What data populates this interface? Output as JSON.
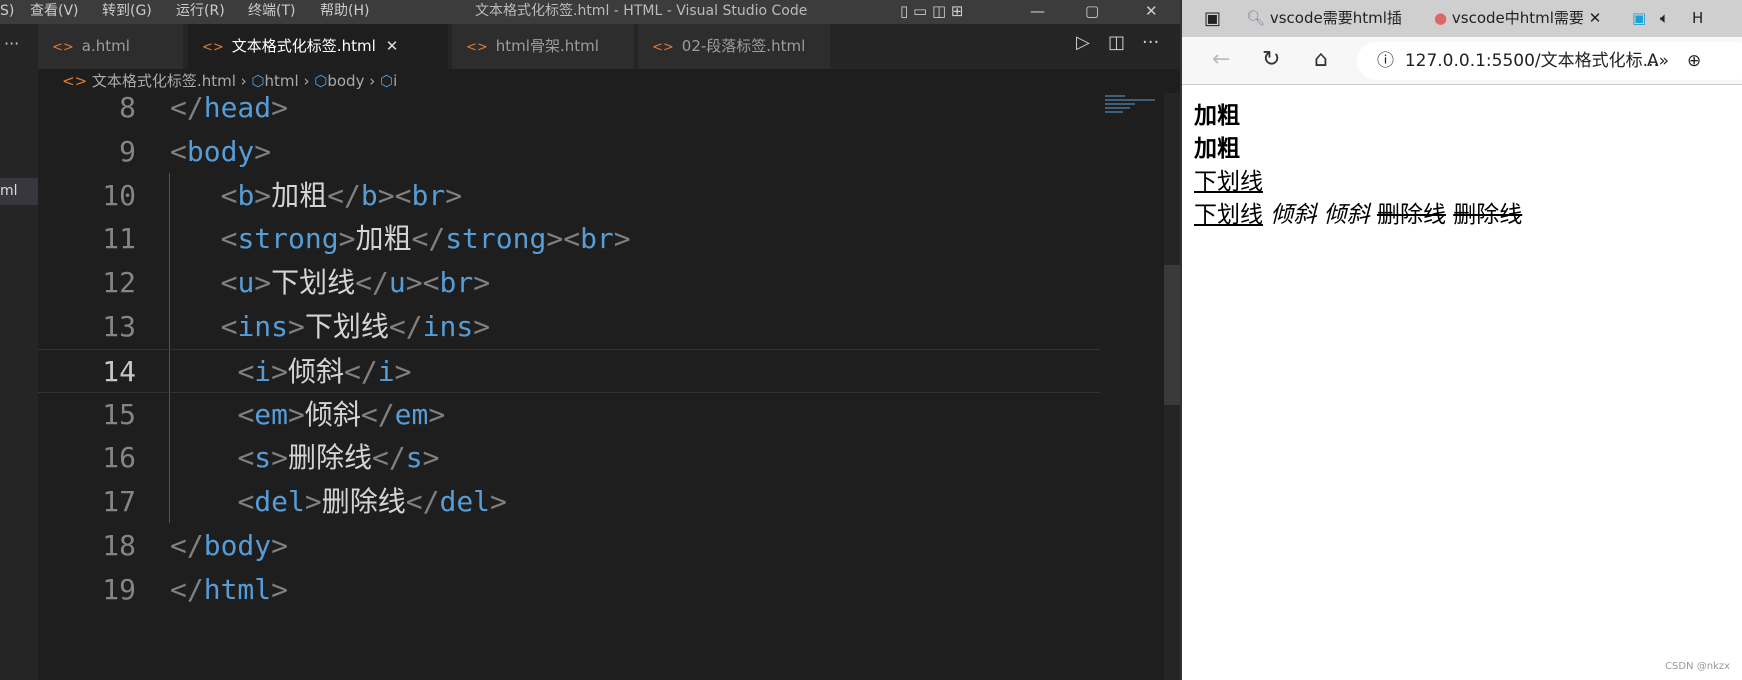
{
  "vscode": {
    "menu": [
      "S)",
      "查看(V)",
      "转到(G)",
      "运行(R)",
      "终端(T)",
      "帮助(H)"
    ],
    "window_title": "文本格式化标签.html - HTML - Visual Studio Code",
    "explorer_partial_item": "ml",
    "tabs": [
      {
        "label": "a.html",
        "active": false
      },
      {
        "label": "文本格式化标签.html",
        "active": true,
        "close": "✕"
      },
      {
        "label": "html骨架.html",
        "active": false
      },
      {
        "label": "02-段落标签.html",
        "active": false
      }
    ],
    "breadcrumb": [
      "文本格式化标签.html",
      "html",
      "body",
      "i"
    ],
    "code_lines": [
      {
        "n": "8",
        "tokens": [
          [
            "punct",
            "</"
          ],
          [
            "tag",
            "head"
          ],
          [
            "punct",
            ">"
          ]
        ]
      },
      {
        "n": "9",
        "tokens": [
          [
            "punct",
            "<"
          ],
          [
            "tag",
            "body"
          ],
          [
            "punct",
            ">"
          ]
        ]
      },
      {
        "n": "10",
        "tokens": [
          [
            "text",
            "   "
          ],
          [
            "punct",
            "<"
          ],
          [
            "tag",
            "b"
          ],
          [
            "punct",
            ">"
          ],
          [
            "text",
            "加粗"
          ],
          [
            "punct",
            "</"
          ],
          [
            "tag",
            "b"
          ],
          [
            "punct",
            "><"
          ],
          [
            "tag",
            "br"
          ],
          [
            "punct",
            ">"
          ]
        ]
      },
      {
        "n": "11",
        "tokens": [
          [
            "text",
            "   "
          ],
          [
            "punct",
            "<"
          ],
          [
            "tag",
            "strong"
          ],
          [
            "punct",
            ">"
          ],
          [
            "text",
            "加粗"
          ],
          [
            "punct",
            "</"
          ],
          [
            "tag",
            "strong"
          ],
          [
            "punct",
            "><"
          ],
          [
            "tag",
            "br"
          ],
          [
            "punct",
            ">"
          ]
        ]
      },
      {
        "n": "12",
        "tokens": [
          [
            "text",
            "   "
          ],
          [
            "punct",
            "<"
          ],
          [
            "tag",
            "u"
          ],
          [
            "punct",
            ">"
          ],
          [
            "text",
            "下划线"
          ],
          [
            "punct",
            "</"
          ],
          [
            "tag",
            "u"
          ],
          [
            "punct",
            "><"
          ],
          [
            "tag",
            "br"
          ],
          [
            "punct",
            ">"
          ]
        ]
      },
      {
        "n": "13",
        "tokens": [
          [
            "text",
            "   "
          ],
          [
            "punct",
            "<"
          ],
          [
            "tag",
            "ins"
          ],
          [
            "punct",
            ">"
          ],
          [
            "text",
            "下划线"
          ],
          [
            "punct",
            "</"
          ],
          [
            "tag",
            "ins"
          ],
          [
            "punct",
            ">"
          ]
        ]
      },
      {
        "n": "14",
        "current": true,
        "tokens": [
          [
            "text",
            "    "
          ],
          [
            "punct",
            "<"
          ],
          [
            "tag",
            "i"
          ],
          [
            "punct",
            ">"
          ],
          [
            "text",
            "倾斜"
          ],
          [
            "punct",
            "</"
          ],
          [
            "tag",
            "i"
          ],
          [
            "punct",
            ">"
          ]
        ]
      },
      {
        "n": "15",
        "tokens": [
          [
            "text",
            "    "
          ],
          [
            "punct",
            "<"
          ],
          [
            "tag",
            "em"
          ],
          [
            "punct",
            ">"
          ],
          [
            "text",
            "倾斜"
          ],
          [
            "punct",
            "</"
          ],
          [
            "tag",
            "em"
          ],
          [
            "punct",
            ">"
          ]
        ]
      },
      {
        "n": "16",
        "tokens": [
          [
            "text",
            "    "
          ],
          [
            "punct",
            "<"
          ],
          [
            "tag",
            "s"
          ],
          [
            "punct",
            ">"
          ],
          [
            "text",
            "删除线"
          ],
          [
            "punct",
            "</"
          ],
          [
            "tag",
            "s"
          ],
          [
            "punct",
            ">"
          ]
        ]
      },
      {
        "n": "17",
        "tokens": [
          [
            "text",
            "    "
          ],
          [
            "punct",
            "<"
          ],
          [
            "tag",
            "del"
          ],
          [
            "punct",
            ">"
          ],
          [
            "text",
            "删除线"
          ],
          [
            "punct",
            "</"
          ],
          [
            "tag",
            "del"
          ],
          [
            "punct",
            ">"
          ]
        ]
      },
      {
        "n": "18",
        "tokens": [
          [
            "punct",
            "</"
          ],
          [
            "tag",
            "body"
          ],
          [
            "punct",
            ">"
          ]
        ]
      },
      {
        "n": "19",
        "tokens": [
          [
            "punct",
            "</"
          ],
          [
            "tag",
            "html"
          ],
          [
            "punct",
            ">"
          ]
        ]
      }
    ]
  },
  "browser": {
    "tabs": [
      {
        "label": "vscode需要html插",
        "close": "✕"
      },
      {
        "label": "vscode中html需要",
        "close": "✕"
      },
      {
        "label": "H"
      }
    ],
    "url": "127.0.0.1:5500/文本格式化标...",
    "content": {
      "b": "加粗",
      "strong": "加粗",
      "u": "下划线",
      "ins": "下划线",
      "i": "倾斜",
      "em": "倾斜",
      "s": "删除线",
      "del": "删除线"
    },
    "watermark": "CSDN @nkzx"
  },
  "colors": {
    "tag": "#569cd6",
    "punct": "#808080",
    "text": "#d4d4d4",
    "editor_bg": "#1e1e1e"
  }
}
